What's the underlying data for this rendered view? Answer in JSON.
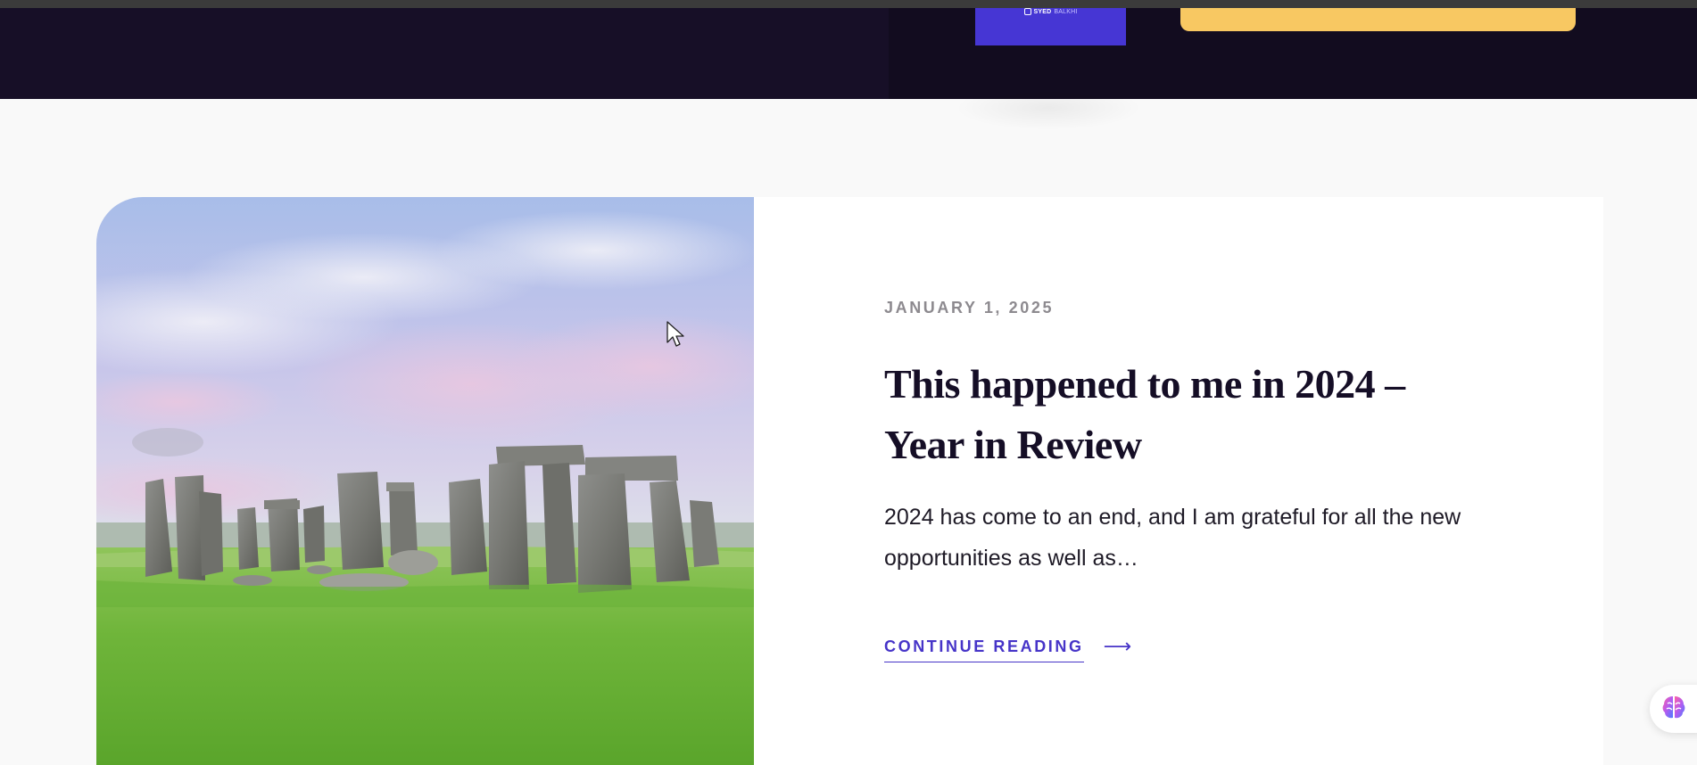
{
  "hero": {
    "promo_logo_main": "SYED",
    "promo_logo_soft": "BALKHI",
    "colors": {
      "band": "#170f27",
      "promo_card": "#4636d4",
      "yellow_bar": "#f8c862"
    }
  },
  "post": {
    "date": "JANUARY 1, 2025",
    "title": "This happened to me in 2024 – Year in Review",
    "excerpt": "2024 has come to an end, and I am grateful for all the new opportunities as well as…",
    "continue_label": "CONTINUE READING",
    "arrow_icon": "arrow-right-icon",
    "image_subject": "stonehenge-photo",
    "colors": {
      "date": "#8d8a8f",
      "title": "#150e26",
      "link": "#4634c8"
    }
  },
  "widgets": {
    "brain_icon": "brain-icon",
    "cursor_icon": "mouse-cursor-icon"
  }
}
